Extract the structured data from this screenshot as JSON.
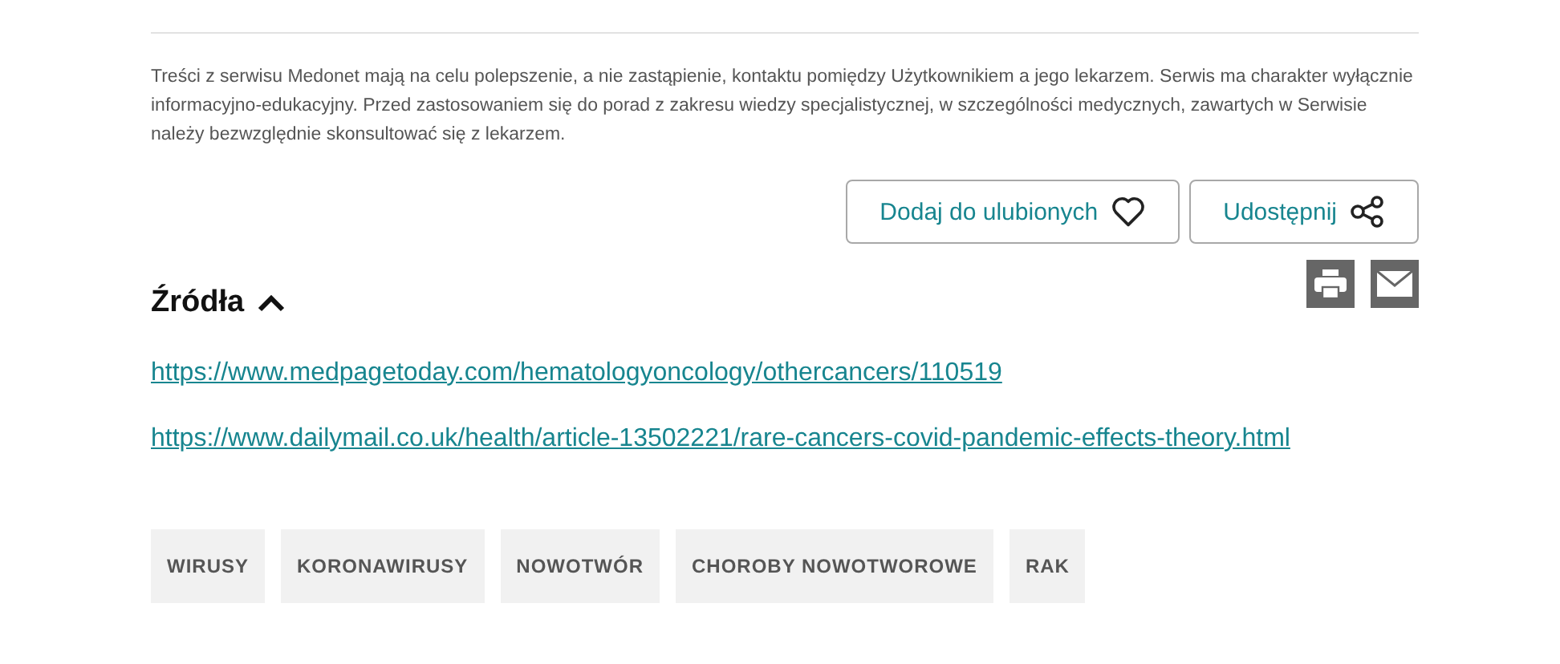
{
  "disclaimer": "Treści z serwisu Medonet mają na celu polepszenie, a nie zastąpienie, kontaktu pomiędzy Użytkownikiem a jego lekarzem. Serwis ma charakter wyłącznie informacyjno-edukacyjny. Przed zastosowaniem się do porad z zakresu wiedzy specjalistycznej, w szczególności medycznych, zawartych w Serwisie należy bezwzględnie skonsultować się z lekarzem.",
  "actions": [
    {
      "label": "Dodaj do ulubionych",
      "kind": "favorite"
    },
    {
      "label": "Udostępnij",
      "kind": "share"
    }
  ],
  "sources": {
    "title": "Źródła",
    "expanded": true,
    "links": [
      "https://www.medpagetoday.com/hematologyoncology/othercancers/110519",
      "https://www.dailymail.co.uk/health/article-13502221/rare-cancers-covid-pandemic-effects-theory.html"
    ]
  },
  "tags": [
    "WIRUSY",
    "KORONAWIRUSY",
    "NOWOTWÓR",
    "CHOROBY NOWOTWOROWE",
    "RAK"
  ]
}
